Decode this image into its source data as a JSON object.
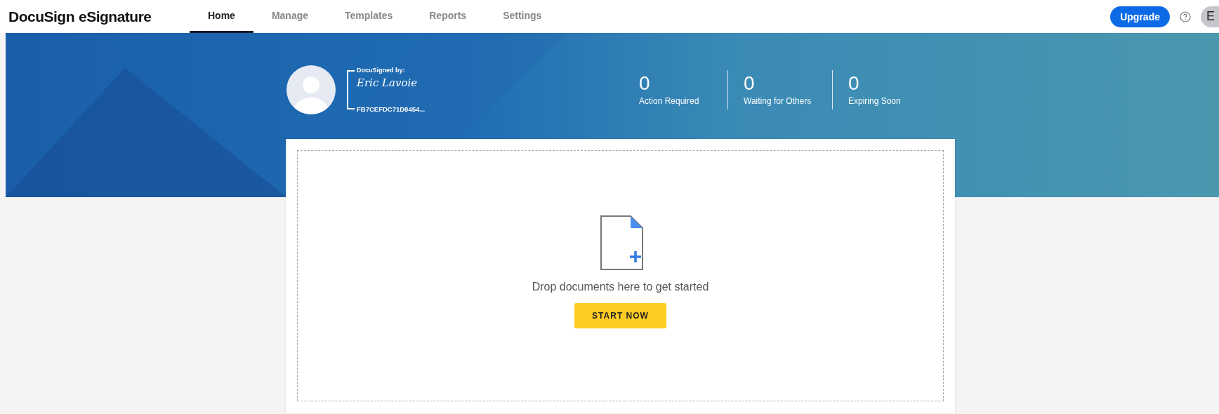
{
  "brand": {
    "name": "DocuSign",
    "suffix": "eSignature"
  },
  "nav": [
    {
      "label": "Home",
      "selected": true
    },
    {
      "label": "Manage",
      "selected": false
    },
    {
      "label": "Templates",
      "selected": false
    },
    {
      "label": "Reports",
      "selected": false
    },
    {
      "label": "Settings",
      "selected": false
    }
  ],
  "upgrade": "Upgrade",
  "account_initial": "E",
  "signature": {
    "caption": "DocuSigned by:",
    "name": "Eric Lavoie",
    "id": "FB7CEFDC71D8454..."
  },
  "stats": [
    {
      "value": "0",
      "label": "Action Required"
    },
    {
      "value": "0",
      "label": "Waiting for Others"
    },
    {
      "value": "0",
      "label": "Expiring Soon"
    }
  ],
  "dropzone": {
    "text": "Drop documents here to get started",
    "button": "START NOW"
  }
}
